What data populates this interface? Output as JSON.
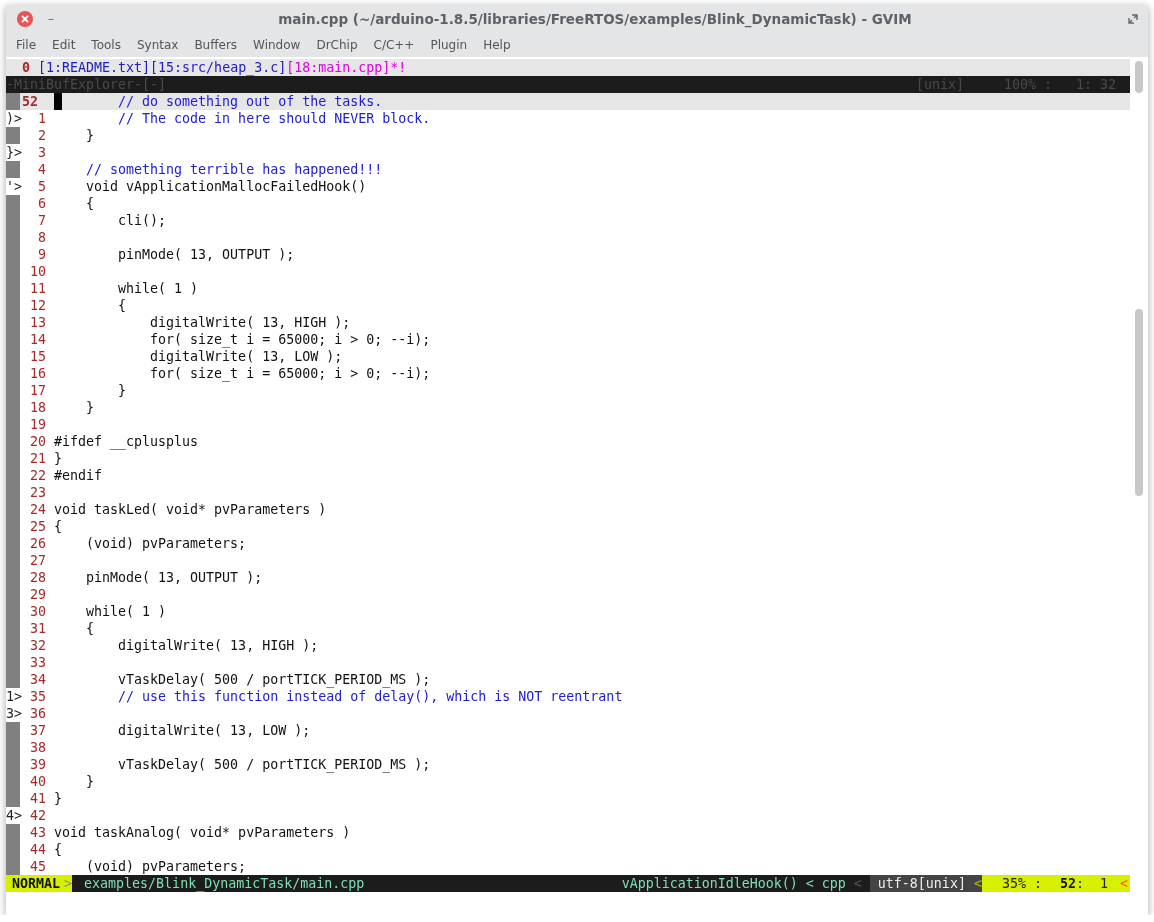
{
  "window": {
    "title": "main.cpp (~/arduino-1.8.5/libraries/FreeRTOS/examples/Blink_DynamicTask) - GVIM",
    "minimize_glyph": "–"
  },
  "menu": [
    "File",
    "Edit",
    "Tools",
    "Syntax",
    "Buffers",
    "Window",
    "DrChip",
    "C/C++",
    "Plugin",
    "Help"
  ],
  "tabline": {
    "count": "0",
    "buffers": [
      {
        "label": "[1:README.txt]",
        "selected": false
      },
      {
        "label": "[15:src/heap_3.c]",
        "selected": false
      },
      {
        "label": "[18:main.cpp]*!",
        "selected": true
      }
    ]
  },
  "minibuf_status": {
    "name": "-MiniBufExplorer-[-]",
    "format": "[unix]",
    "position": "100% :   1: 32"
  },
  "cursor_line": {
    "number": "52",
    "text": "        // do something out of the tasks.",
    "kind": "comment"
  },
  "lines": [
    {
      "sign": ")>",
      "number": "1",
      "text": "        // The code in here should NEVER block.",
      "kind": "comment"
    },
    {
      "number": "2",
      "text": "    }",
      "kind": "code"
    },
    {
      "sign": "}>",
      "number": "3"
    },
    {
      "number": "4",
      "text": "    // something terrible has happened!!!",
      "kind": "comment"
    },
    {
      "sign": "'>",
      "number": "5",
      "text": "    void vApplicationMallocFailedHook()",
      "kind": "code"
    },
    {
      "number": "6",
      "text": "    {",
      "kind": "code"
    },
    {
      "number": "7",
      "text": "        cli();",
      "kind": "code"
    },
    {
      "number": "8"
    },
    {
      "number": "9",
      "text": "        pinMode( 13, OUTPUT );",
      "kind": "code"
    },
    {
      "number": "10"
    },
    {
      "number": "11",
      "text": "        while( 1 )",
      "kind": "code"
    },
    {
      "number": "12",
      "text": "        {",
      "kind": "code"
    },
    {
      "number": "13",
      "text": "            digitalWrite( 13, HIGH );",
      "kind": "code"
    },
    {
      "number": "14",
      "text": "            for( size_t i = 65000; i > 0; --i);",
      "kind": "code"
    },
    {
      "number": "15",
      "text": "            digitalWrite( 13, LOW );",
      "kind": "code"
    },
    {
      "number": "16",
      "text": "            for( size_t i = 65000; i > 0; --i);",
      "kind": "code"
    },
    {
      "number": "17",
      "text": "        }",
      "kind": "code"
    },
    {
      "number": "18",
      "text": "    }",
      "kind": "code"
    },
    {
      "number": "19"
    },
    {
      "number": "20",
      "text": "#ifdef __cplusplus",
      "kind": "code"
    },
    {
      "number": "21",
      "text": "}",
      "kind": "code"
    },
    {
      "number": "22",
      "text": "#endif",
      "kind": "code"
    },
    {
      "number": "23"
    },
    {
      "number": "24",
      "text": "void taskLed( void* pvParameters )",
      "kind": "code"
    },
    {
      "number": "25",
      "text": "{",
      "kind": "code"
    },
    {
      "number": "26",
      "text": "    (void) pvParameters;",
      "kind": "code"
    },
    {
      "number": "27"
    },
    {
      "number": "28",
      "text": "    pinMode( 13, OUTPUT );",
      "kind": "code"
    },
    {
      "number": "29"
    },
    {
      "number": "30",
      "text": "    while( 1 )",
      "kind": "code"
    },
    {
      "number": "31",
      "text": "    {",
      "kind": "code"
    },
    {
      "number": "32",
      "text": "        digitalWrite( 13, HIGH );",
      "kind": "code"
    },
    {
      "number": "33"
    },
    {
      "number": "34",
      "text": "        vTaskDelay( 500 / portTICK_PERIOD_MS );",
      "kind": "code"
    },
    {
      "sign": "1>",
      "number": "35",
      "text": "        // use this function instead of delay(), which is NOT reentrant",
      "kind": "comment"
    },
    {
      "sign": "3>",
      "number": "36"
    },
    {
      "number": "37",
      "text": "        digitalWrite( 13, LOW );",
      "kind": "code"
    },
    {
      "number": "38"
    },
    {
      "number": "39",
      "text": "        vTaskDelay( 500 / portTICK_PERIOD_MS );",
      "kind": "code"
    },
    {
      "number": "40",
      "text": "    }",
      "kind": "code"
    },
    {
      "number": "41",
      "text": "}",
      "kind": "code"
    },
    {
      "sign": "4>",
      "number": "42"
    },
    {
      "number": "43",
      "text": "void taskAnalog( void* pvParameters )",
      "kind": "code"
    },
    {
      "number": "44",
      "text": "{",
      "kind": "code"
    },
    {
      "number": "45",
      "text": "    (void) pvParameters;",
      "kind": "code"
    }
  ],
  "statusline": {
    "mode": "NORMAL",
    "mode_sep": ">",
    "file": "examples/Blink_DynamicTask/main.cpp",
    "function": "vApplicationIdleHook() < cpp",
    "sep_1": "<",
    "encoding": "utf-8[unix]",
    "sep_2": "<",
    "percent": "35% :",
    "line": "52",
    "column": ":  1",
    "sep_3": "<"
  }
}
